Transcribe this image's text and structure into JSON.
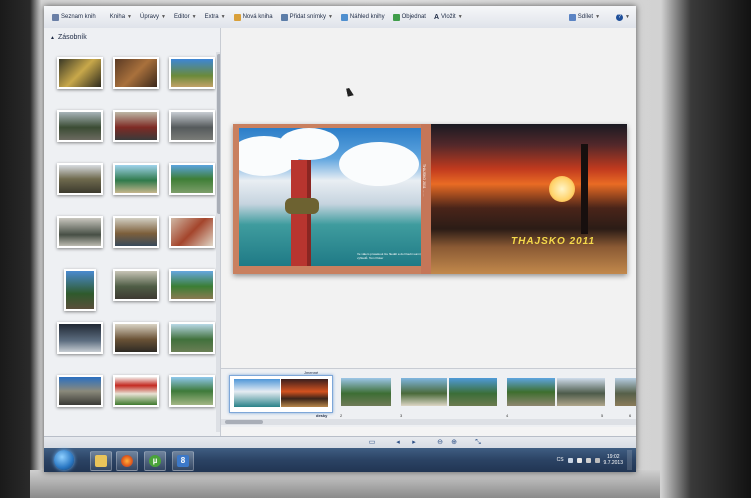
{
  "toolbar": {
    "items": [
      {
        "label": "Seznam knih",
        "icon": "book-list-icon"
      },
      {
        "label": "Kniha"
      },
      {
        "label": "Úpravy"
      },
      {
        "label": "Editor"
      },
      {
        "label": "Extra"
      },
      {
        "label": "Nová kniha",
        "icon": "new-book-icon"
      },
      {
        "label": "Přidat snímky",
        "icon": "add-photos-icon"
      },
      {
        "label": "Náhled knihy",
        "icon": "preview-icon"
      },
      {
        "label": "Objednat",
        "icon": "order-icon"
      },
      {
        "label": "Vložit",
        "icon": "text-insert-icon"
      }
    ],
    "share_label": "Sdílet",
    "help_icon": "help-icon"
  },
  "tray": {
    "title": "Zásobník"
  },
  "canvas": {
    "book_title": "THAJSKO 2011",
    "spine_text": "THAJSKO 2011 ... ...",
    "caption": "Ve válem prosekout lze hledět a do hloubi sumných výhledů. Tom Poker"
  },
  "filmstrip": {
    "selected_tag": "Jmenné",
    "selected_caption": "desky",
    "page_numbers": [
      "2",
      "3",
      "4",
      "5",
      "6"
    ]
  },
  "taskbar": {
    "language": "CS",
    "time": "19:02",
    "date": "9.7.2013"
  },
  "colors": {
    "accent": "#2c4f86",
    "book_title": "#f5d94a",
    "taskbar": "#2b4364"
  }
}
